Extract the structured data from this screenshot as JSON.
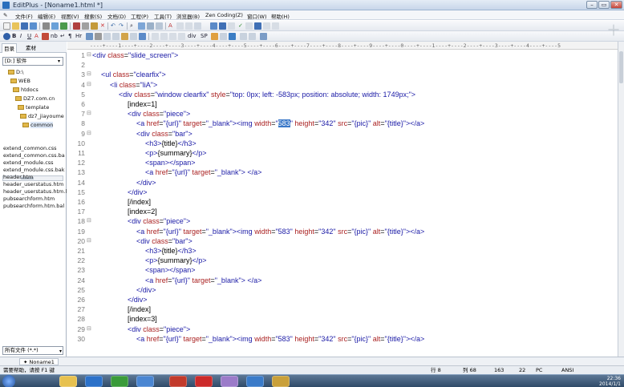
{
  "window": {
    "title": "EditPlus - [Noname1.html *]"
  },
  "menu": [
    "文件(F)",
    "编辑(E)",
    "视图(V)",
    "搜索(S)",
    "文档(D)",
    "工程(P)",
    "工具(T)",
    "浏览器(B)",
    "Zen Coding(Z)",
    "窗口(W)",
    "帮助(H)"
  ],
  "sidebar": {
    "tabs": [
      "目录",
      "素材"
    ],
    "drive": "[D:] 软件",
    "folders": [
      "D:\\",
      "WEB",
      "htdocs",
      "DZ7.com.cn",
      "template",
      "dz7_jiayoume",
      "common"
    ],
    "files": [
      "extend_common.css",
      "extend_common.css.ba",
      "extend_module.css",
      "extend_module.css.bak",
      "header.htm",
      "header_userstatus.htm",
      "header_userstatus.htm.l",
      "pubsearchform.htm",
      "pubsearchform.htm.bal"
    ],
    "filter": "所有文件 (*.*)"
  },
  "editor": {
    "ruler": "----+----1----+----2----+----3----+----4----+----5----+----6----+----7----+----8----+----9----+----0----+----1----+----2----+----3----+----4----+----5",
    "lines": [
      {
        "n": "1",
        "f": "⊟",
        "ind": 0,
        "s": [
          [
            "tg",
            "<div "
          ],
          [
            "at",
            "class"
          ],
          [
            "tx",
            "="
          ],
          [
            "vl",
            "\"slide_screen\""
          ],
          [
            "tg",
            ">"
          ]
        ]
      },
      {
        "n": "2",
        "f": "",
        "ind": 0,
        "s": []
      },
      {
        "n": "3",
        "f": "⊟",
        "ind": 1,
        "s": [
          [
            "tg",
            "<ul "
          ],
          [
            "at",
            "class"
          ],
          [
            "tx",
            "="
          ],
          [
            "vl",
            "\"clearfix\""
          ],
          [
            "tg",
            ">"
          ]
        ]
      },
      {
        "n": "4",
        "f": "⊟",
        "ind": 2,
        "s": [
          [
            "tg",
            "<li "
          ],
          [
            "at",
            "class"
          ],
          [
            "tx",
            "="
          ],
          [
            "vl",
            "\"liA\""
          ],
          [
            "tg",
            ">"
          ]
        ]
      },
      {
        "n": "5",
        "f": "",
        "ind": 3,
        "s": [
          [
            "tg",
            "<div "
          ],
          [
            "at",
            "class"
          ],
          [
            "tx",
            "="
          ],
          [
            "vl",
            "\"window clearfix\" "
          ],
          [
            "at",
            "style"
          ],
          [
            "tx",
            "="
          ],
          [
            "vl",
            "\"top: 0px; left: -583px; position: absolute; width: 1749px;\""
          ],
          [
            "tg",
            ">"
          ]
        ]
      },
      {
        "n": "6",
        "f": "",
        "ind": 4,
        "s": [
          [
            "tx",
            "[index=1]"
          ]
        ]
      },
      {
        "n": "7",
        "f": "⊟",
        "ind": 4,
        "s": [
          [
            "tg",
            "<div "
          ],
          [
            "at",
            "class"
          ],
          [
            "tx",
            "="
          ],
          [
            "vl",
            "\"piece\""
          ],
          [
            "tg",
            ">"
          ]
        ]
      },
      {
        "n": "8",
        "f": "",
        "ind": 5,
        "s": [
          [
            "tg",
            "<a "
          ],
          [
            "at",
            "href"
          ],
          [
            "tx",
            "="
          ],
          [
            "vl",
            "\"{url}\" "
          ],
          [
            "at",
            "target"
          ],
          [
            "tx",
            "="
          ],
          [
            "vl",
            "\"_blank\""
          ],
          [
            "tg",
            ">"
          ],
          [
            "tg",
            "<img "
          ],
          [
            "at",
            "width"
          ],
          [
            "tx",
            "="
          ],
          [
            "vl",
            "\""
          ],
          [
            "hl",
            "583"
          ],
          [
            "vl",
            "\" "
          ],
          [
            "at",
            "height"
          ],
          [
            "tx",
            "="
          ],
          [
            "vl",
            "\"342\" "
          ],
          [
            "at",
            "src"
          ],
          [
            "tx",
            "="
          ],
          [
            "vl",
            "\"{pic}\" "
          ],
          [
            "at",
            "alt"
          ],
          [
            "tx",
            "="
          ],
          [
            "vl",
            "\"{title}\""
          ],
          [
            "tg",
            "></a>"
          ]
        ]
      },
      {
        "n": "9",
        "f": "⊟",
        "ind": 5,
        "s": [
          [
            "tg",
            "<div "
          ],
          [
            "at",
            "class"
          ],
          [
            "tx",
            "="
          ],
          [
            "vl",
            "\"bar\""
          ],
          [
            "tg",
            ">"
          ]
        ]
      },
      {
        "n": "10",
        "f": "",
        "ind": 6,
        "s": [
          [
            "tg",
            "<h3>"
          ],
          [
            "tx",
            "{title}"
          ],
          [
            "tg",
            "</h3>"
          ]
        ]
      },
      {
        "n": "11",
        "f": "",
        "ind": 6,
        "s": [
          [
            "tg",
            "<p>"
          ],
          [
            "tx",
            "{summary}"
          ],
          [
            "tg",
            "</p>"
          ]
        ]
      },
      {
        "n": "12",
        "f": "",
        "ind": 6,
        "s": [
          [
            "tg",
            "<span></span>"
          ]
        ]
      },
      {
        "n": "13",
        "f": "",
        "ind": 6,
        "s": [
          [
            "tg",
            "<a "
          ],
          [
            "at",
            "href"
          ],
          [
            "tx",
            "="
          ],
          [
            "vl",
            "\"{url}\" "
          ],
          [
            "at",
            "target"
          ],
          [
            "tx",
            "="
          ],
          [
            "vl",
            "\"_blank\""
          ],
          [
            "tg",
            "> </a>"
          ]
        ]
      },
      {
        "n": "14",
        "f": "",
        "ind": 5,
        "s": [
          [
            "tg",
            "</div>"
          ]
        ]
      },
      {
        "n": "15",
        "f": "",
        "ind": 4,
        "s": [
          [
            "tg",
            "</div>"
          ]
        ]
      },
      {
        "n": "16",
        "f": "",
        "ind": 4,
        "s": [
          [
            "tx",
            "[/index]"
          ]
        ]
      },
      {
        "n": "17",
        "f": "",
        "ind": 4,
        "s": [
          [
            "tx",
            "[index=2]"
          ]
        ]
      },
      {
        "n": "18",
        "f": "⊟",
        "ind": 4,
        "s": [
          [
            "tg",
            "<div "
          ],
          [
            "at",
            "class"
          ],
          [
            "tx",
            "="
          ],
          [
            "vl",
            "\"piece\""
          ],
          [
            "tg",
            ">"
          ]
        ]
      },
      {
        "n": "19",
        "f": "",
        "ind": 5,
        "s": [
          [
            "tg",
            "<a "
          ],
          [
            "at",
            "href"
          ],
          [
            "tx",
            "="
          ],
          [
            "vl",
            "\"{url}\" "
          ],
          [
            "at",
            "target"
          ],
          [
            "tx",
            "="
          ],
          [
            "vl",
            "\"_blank\""
          ],
          [
            "tg",
            ">"
          ],
          [
            "tg",
            "<img "
          ],
          [
            "at",
            "width"
          ],
          [
            "tx",
            "="
          ],
          [
            "vl",
            "\"583\" "
          ],
          [
            "at",
            "height"
          ],
          [
            "tx",
            "="
          ],
          [
            "vl",
            "\"342\" "
          ],
          [
            "at",
            "src"
          ],
          [
            "tx",
            "="
          ],
          [
            "vl",
            "\"{pic}\" "
          ],
          [
            "at",
            "alt"
          ],
          [
            "tx",
            "="
          ],
          [
            "vl",
            "\"{title}\""
          ],
          [
            "tg",
            "></a>"
          ]
        ]
      },
      {
        "n": "20",
        "f": "⊟",
        "ind": 5,
        "s": [
          [
            "tg",
            "<div "
          ],
          [
            "at",
            "class"
          ],
          [
            "tx",
            "="
          ],
          [
            "vl",
            "\"bar\""
          ],
          [
            "tg",
            ">"
          ]
        ]
      },
      {
        "n": "21",
        "f": "",
        "ind": 6,
        "s": [
          [
            "tg",
            "<h3>"
          ],
          [
            "tx",
            "{title}"
          ],
          [
            "tg",
            "</h3>"
          ]
        ]
      },
      {
        "n": "22",
        "f": "",
        "ind": 6,
        "s": [
          [
            "tg",
            "<p>"
          ],
          [
            "tx",
            "{summary}"
          ],
          [
            "tg",
            "</p>"
          ]
        ]
      },
      {
        "n": "23",
        "f": "",
        "ind": 6,
        "s": [
          [
            "tg",
            "<span></span>"
          ]
        ]
      },
      {
        "n": "24",
        "f": "",
        "ind": 6,
        "s": [
          [
            "tg",
            "<a "
          ],
          [
            "at",
            "href"
          ],
          [
            "tx",
            "="
          ],
          [
            "vl",
            "\"{url}\" "
          ],
          [
            "at",
            "target"
          ],
          [
            "tx",
            "="
          ],
          [
            "vl",
            "\"_blank\""
          ],
          [
            "tg",
            "> </a>"
          ]
        ]
      },
      {
        "n": "25",
        "f": "",
        "ind": 5,
        "s": [
          [
            "tg",
            "</div>"
          ]
        ]
      },
      {
        "n": "26",
        "f": "",
        "ind": 4,
        "s": [
          [
            "tg",
            "</div>"
          ]
        ]
      },
      {
        "n": "27",
        "f": "",
        "ind": 4,
        "s": [
          [
            "tx",
            "[/index]"
          ]
        ]
      },
      {
        "n": "28",
        "f": "",
        "ind": 4,
        "s": [
          [
            "tx",
            "[index=3]"
          ]
        ]
      },
      {
        "n": "29",
        "f": "⊟",
        "ind": 4,
        "s": [
          [
            "tg",
            "<div "
          ],
          [
            "at",
            "class"
          ],
          [
            "tx",
            "="
          ],
          [
            "vl",
            "\"piece\""
          ],
          [
            "tg",
            ">"
          ]
        ]
      },
      {
        "n": "30",
        "f": "",
        "ind": 5,
        "s": [
          [
            "tg",
            "<a "
          ],
          [
            "at",
            "href"
          ],
          [
            "tx",
            "="
          ],
          [
            "vl",
            "\"{url}\" "
          ],
          [
            "at",
            "target"
          ],
          [
            "tx",
            "="
          ],
          [
            "vl",
            "\"_blank\""
          ],
          [
            "tg",
            ">"
          ],
          [
            "tg",
            "<img "
          ],
          [
            "at",
            "width"
          ],
          [
            "tx",
            "="
          ],
          [
            "vl",
            "\"583\" "
          ],
          [
            "at",
            "height"
          ],
          [
            "tx",
            "="
          ],
          [
            "vl",
            "\"342\" "
          ],
          [
            "at",
            "src"
          ],
          [
            "tx",
            "="
          ],
          [
            "vl",
            "\"{pic}\" "
          ],
          [
            "at",
            "alt"
          ],
          [
            "tx",
            "="
          ],
          [
            "vl",
            "\"{title}\""
          ],
          [
            "tg",
            "></a>"
          ]
        ]
      }
    ]
  },
  "doc_tab": "Noname1",
  "status": {
    "help": "需要帮助，请按 F1 键",
    "line": "行 8",
    "col": "列 68",
    "num": "163",
    "n22": "22",
    "pc": "PC",
    "enc": "ANSI"
  },
  "taskbar": {
    "time": "22:36",
    "date": "2014/1/1"
  },
  "colors": {
    "tag": "#1a1aa6",
    "attr": "#aa2222",
    "highlight": "#3a78c8"
  }
}
